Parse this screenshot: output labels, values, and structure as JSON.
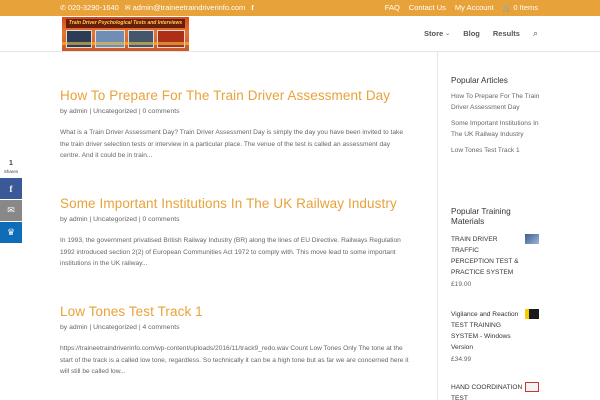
{
  "topbar": {
    "phone": "020-3290-1640",
    "email": "admin@traineetraindriverinfo.com",
    "links": [
      "FAQ",
      "Contact Us",
      "My Account"
    ],
    "cart": "0 Items"
  },
  "logo": {
    "banner_text": "Train Driver Psychological Tests and Interviews"
  },
  "nav": {
    "items": [
      "Store",
      "Blog",
      "Results"
    ]
  },
  "posts": [
    {
      "title": "How To Prepare For The Train Driver Assessment Day",
      "meta": "by admin | Uncategorized | 0 comments",
      "excerpt": "What is a Train Driver Assessment Day? Train Driver Assessment Day is simply the day you have been invited to take the train driver selection tests or interview in a particular place. The venue of the test is called an assessment day centre. And it could be in train..."
    },
    {
      "title": "Some Important Institutions In The UK Railway Industry",
      "meta": "by admin | Uncategorized | 0 comments",
      "excerpt": "In 1993, the government privatised British Railway Industry (BR) along the lines of EU Directive. Railways Regulation 1992 introduced section 2(2) of European Communities Act 1972 to comply with. This move lead to some important institutions in the UK railway..."
    },
    {
      "title": "Low Tones Test Track 1",
      "meta": "by admin | Uncategorized | 4 comments",
      "excerpt": "https://traineetraindriverinfo.com/wp-content/uploads/2016/11/track9_redo.wav Count Low Tones Only The tone at the start of the track is a called low tone, regardless. So technically it can be a high tone but as far we are concerned here it will still be called low..."
    }
  ],
  "sidebar": {
    "popular_articles_heading": "Popular Articles",
    "popular_articles": [
      "How To Prepare For The Train Driver Assessment Day",
      "Some Important Institutions In The UK Railway Industry",
      "Low Tones Test Track 1"
    ],
    "materials_heading": "Popular Training Materials",
    "products": [
      {
        "name": "TRAIN DRIVER TRAFFIC PERCEPTION TEST & PRACTICE SYSTEM",
        "price": "£19.00"
      },
      {
        "name": "Vigilance and Reaction TEST TRAINING SYSTEM - Windows Version",
        "price": "£34.99"
      },
      {
        "name": "HAND COORDINATION TEST",
        "price": ""
      }
    ]
  },
  "share": {
    "count": "1",
    "label": "Shares"
  },
  "colors": {
    "accent": "#e8a23a",
    "facebook": "#3b5998",
    "email": "#888888",
    "sumo": "#0f6db8"
  }
}
